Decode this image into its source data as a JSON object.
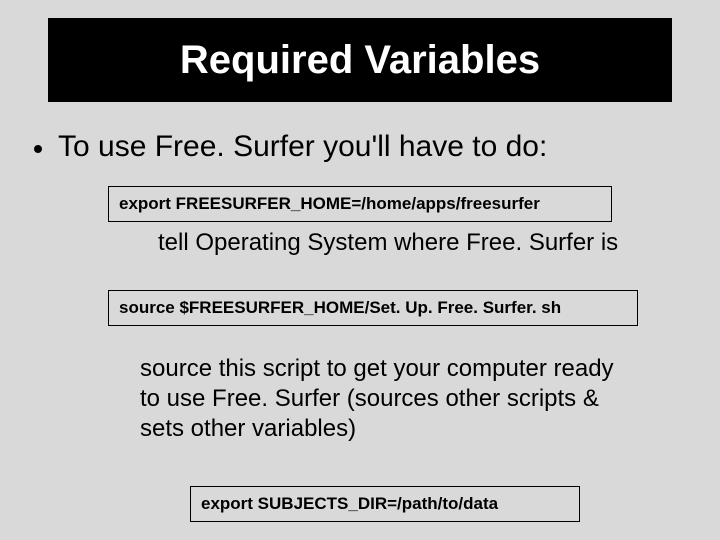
{
  "title": "Required Variables",
  "bullet": "To use Free. Surfer you'll have to do:",
  "box1": "export   FREESURFER_HOME=/home/apps/freesurfer",
  "desc1": "tell Operating System where Free. Surfer is",
  "box2": "source     $FREESURFER_HOME/Set. Up. Free. Surfer. sh",
  "desc2": "source this script to get your computer ready to use Free. Surfer (sources other scripts & sets other variables)",
  "box3": "export    SUBJECTS_DIR=/path/to/data"
}
